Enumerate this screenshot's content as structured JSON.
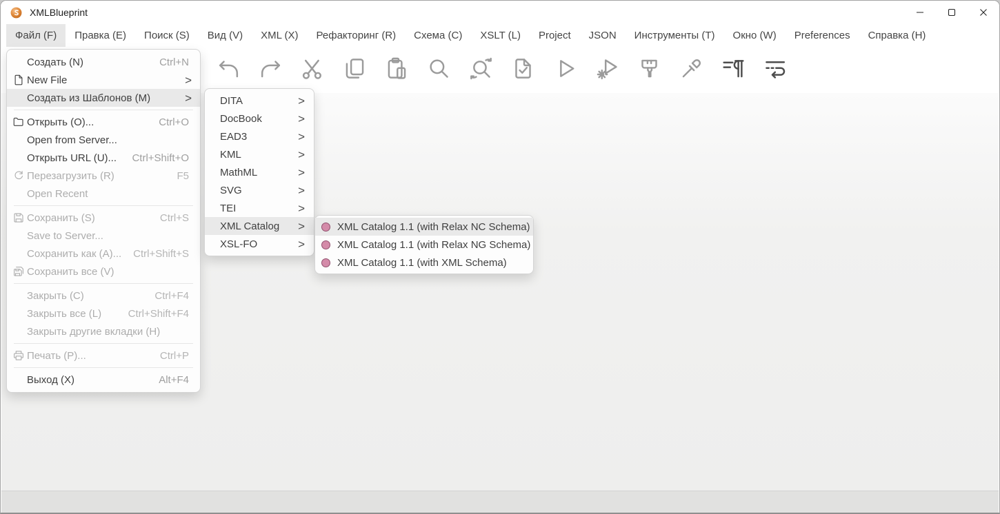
{
  "window": {
    "title": "XMLBlueprint"
  },
  "colors": {
    "highlight_row": "#e9e9e9",
    "menu_text": "#3f3f3f",
    "disabled_text": "#adadad",
    "catalog_dot_fill": "#d48ba9",
    "catalog_dot_border": "#91506e",
    "app_icon_orange": "#e07c28"
  },
  "window_controls": [
    "minimize-icon",
    "maximize-icon",
    "close-icon"
  ],
  "menu_bar": {
    "items": [
      {
        "label": "Файл (F)",
        "active": true
      },
      {
        "label": "Правка (E)"
      },
      {
        "label": "Поиск (S)"
      },
      {
        "label": "Вид (V)"
      },
      {
        "label": "XML (X)"
      },
      {
        "label": "Рефакторинг (R)"
      },
      {
        "label": "Схема (C)"
      },
      {
        "label": "XSLT (L)"
      },
      {
        "label": "Project"
      },
      {
        "label": "JSON"
      },
      {
        "label": "Инструменты (T)"
      },
      {
        "label": "Окно (W)"
      },
      {
        "label": "Preferences"
      },
      {
        "label": "Справка (H)"
      }
    ]
  },
  "toolbar": {
    "buttons": [
      {
        "icon": "undo-icon"
      },
      {
        "icon": "redo-icon"
      },
      {
        "icon": "cut-icon"
      },
      {
        "icon": "copy-icon"
      },
      {
        "icon": "paste-icon"
      },
      {
        "icon": "find-icon"
      },
      {
        "icon": "find-again-icon"
      },
      {
        "icon": "validate-document-icon"
      },
      {
        "icon": "run-icon"
      },
      {
        "icon": "run-configuration-icon"
      },
      {
        "icon": "format-brush-icon"
      },
      {
        "icon": "color-picker-icon"
      },
      {
        "icon": "formatting-marks-icon"
      },
      {
        "icon": "word-wrap-icon"
      }
    ]
  },
  "file_menu": {
    "sections": [
      {
        "items": [
          {
            "label": "Создать (N)",
            "shortcut": "Ctrl+N",
            "enabled": true
          },
          {
            "label": "New File",
            "icon": "new-file-icon",
            "submenu": ">",
            "enabled": true
          },
          {
            "label": "Создать из Шаблонов (M)",
            "submenu": ">",
            "enabled": true,
            "highlighted": true
          }
        ]
      },
      {
        "items": [
          {
            "label": "Открыть (O)...",
            "shortcut": "Ctrl+O",
            "icon": "open-folder-icon",
            "enabled": true
          },
          {
            "label": "Open from Server...",
            "enabled": true
          },
          {
            "label": "Открыть URL (U)...",
            "shortcut": "Ctrl+Shift+O",
            "enabled": true
          },
          {
            "label": "Перезагрузить (R)",
            "shortcut": "F5",
            "icon": "reload-icon",
            "enabled": false
          },
          {
            "label": "Open Recent",
            "enabled": false
          }
        ]
      },
      {
        "items": [
          {
            "label": "Сохранить (S)",
            "shortcut": "Ctrl+S",
            "icon": "save-icon",
            "enabled": false
          },
          {
            "label": "Save to Server...",
            "enabled": false
          },
          {
            "label": "Сохранить как (A)...",
            "shortcut": "Ctrl+Shift+S",
            "enabled": false
          },
          {
            "label": "Сохранить все (V)",
            "icon": "save-all-icon",
            "enabled": false
          }
        ]
      },
      {
        "items": [
          {
            "label": "Закрыть (C)",
            "shortcut": "Ctrl+F4",
            "enabled": false
          },
          {
            "label": "Закрыть все (L)",
            "shortcut": "Ctrl+Shift+F4",
            "enabled": false
          },
          {
            "label": "Закрыть другие вкладки (H)",
            "enabled": false
          }
        ]
      },
      {
        "items": [
          {
            "label": "Печать (P)...",
            "shortcut": "Ctrl+P",
            "icon": "print-icon",
            "enabled": false
          }
        ]
      },
      {
        "items": [
          {
            "label": "Выход (X)",
            "shortcut": "Alt+F4",
            "enabled": true
          }
        ]
      }
    ]
  },
  "templates_menu": {
    "items": [
      {
        "label": "DITA",
        "submenu": ">"
      },
      {
        "label": "DocBook",
        "submenu": ">"
      },
      {
        "label": "EAD3",
        "submenu": ">"
      },
      {
        "label": "KML",
        "submenu": ">"
      },
      {
        "label": "MathML",
        "submenu": ">"
      },
      {
        "label": "SVG",
        "submenu": ">"
      },
      {
        "label": "TEI",
        "submenu": ">"
      },
      {
        "label": "XML Catalog",
        "submenu": ">",
        "highlighted": true
      },
      {
        "label": "XSL-FO",
        "submenu": ">"
      }
    ]
  },
  "catalog_menu": {
    "items": [
      {
        "label": "XML Catalog 1.1 (with Relax NC Schema)",
        "highlighted": true
      },
      {
        "label": "XML Catalog 1.1 (with Relax NG Schema)"
      },
      {
        "label": "XML Catalog 1.1 (with XML Schema)"
      }
    ]
  }
}
